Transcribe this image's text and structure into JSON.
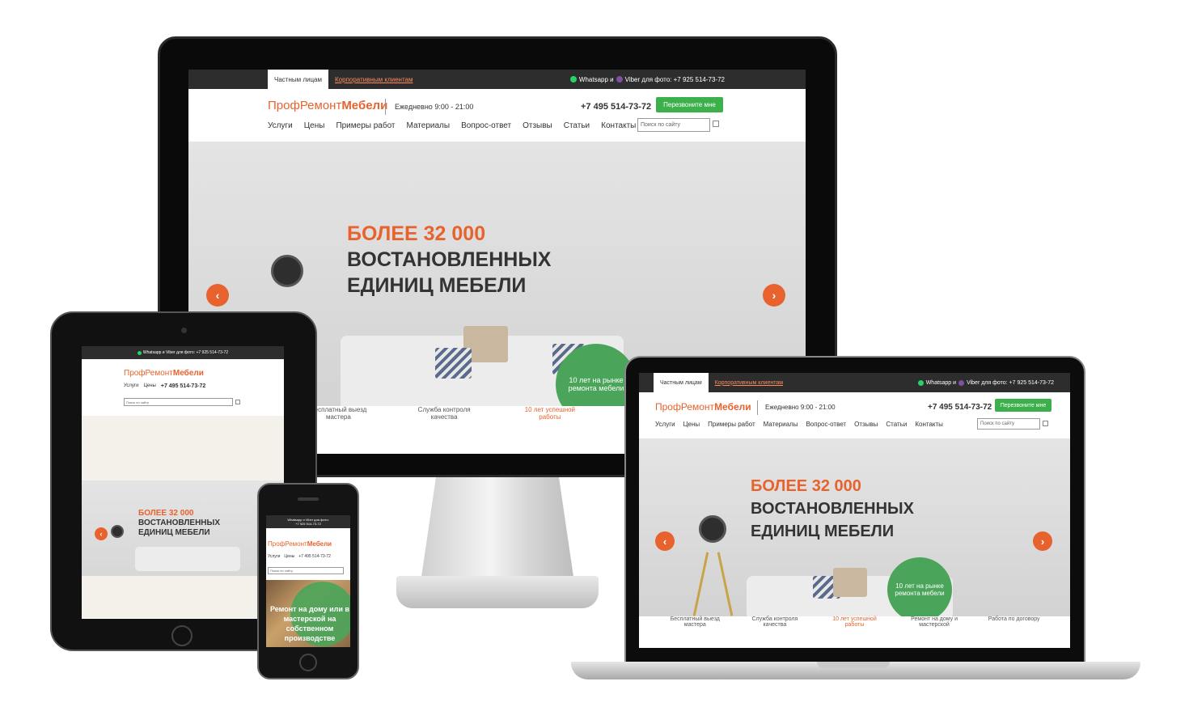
{
  "topbar": {
    "tab_private": "Частным лицам",
    "tab_corporate": "Корпоративным клиентам",
    "whatsapp": "Whatsapp и",
    "viber_label": "Viber для фото: +7 925 514-73-72",
    "tablet_line": "Whatsapp и Viber для фото: +7 925 514-73-72",
    "phone_line1": "Whatsapp и Viber для фото:",
    "phone_line2": "+7 925 514-73-72"
  },
  "header": {
    "logo_part1": "Проф",
    "logo_part2": "Ремонт",
    "logo_part3": "Мебели",
    "hours": "Ежедневно 9:00 - 21:00",
    "phone": "+7 495 514-73-72",
    "callback_button": "Перезвоните мне",
    "search_placeholder": "Поиск по сайту"
  },
  "nav": {
    "items": [
      "Услуги",
      "Цены",
      "Примеры работ",
      "Материалы",
      "Вопрос-ответ",
      "Отзывы",
      "Статьи",
      "Контакты"
    ]
  },
  "hero": {
    "line1": "БОЛЕЕ 32 000",
    "line2": "ВОСТАНОВЛЕННЫХ",
    "line3": "ЕДИНИЦ МЕБЕЛИ",
    "badge": "10 лет на рынке ремонта мебели",
    "prev_icon": "chevron-left-icon",
    "next_icon": "chevron-right-icon"
  },
  "features": {
    "items": [
      "Бесплатный выезд мастера",
      "Служба контроля качества",
      "10 лет успешной работы",
      "Ремонт на дому и мастерской",
      "Работа по договору"
    ]
  },
  "phone_hero": {
    "text": "Ремонт на дому или в мастерской на собственном производстве"
  },
  "colors": {
    "accent": "#e8622d",
    "callback_green": "#3cb04a",
    "badge_green": "#4aa55a",
    "topbar": "#2d2d2d"
  }
}
